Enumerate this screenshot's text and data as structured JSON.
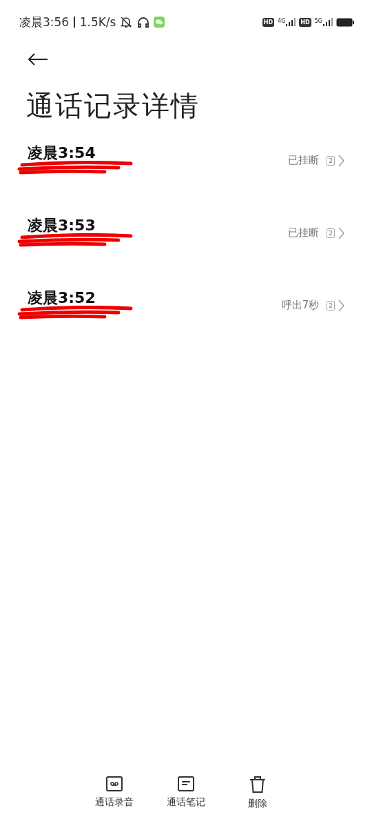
{
  "status_bar": {
    "time": "凌晨3:56",
    "speed": "1.5K/s",
    "sims": [
      {
        "hd": "HD",
        "network": "4G"
      },
      {
        "hd": "HD",
        "network": "5G"
      }
    ]
  },
  "title": "通话记录详情",
  "calls": [
    {
      "time": "凌晨3:54",
      "status": "已挂断",
      "sim": "2"
    },
    {
      "time": "凌晨3:53",
      "status": "已挂断",
      "sim": "2"
    },
    {
      "time": "凌晨3:52",
      "status": "呼出7秒",
      "sim": "2"
    }
  ],
  "bottom_actions": [
    {
      "kind": "recording",
      "label": "通话录音"
    },
    {
      "kind": "note",
      "label": "通话笔记"
    },
    {
      "kind": "delete",
      "label": "删除"
    }
  ]
}
